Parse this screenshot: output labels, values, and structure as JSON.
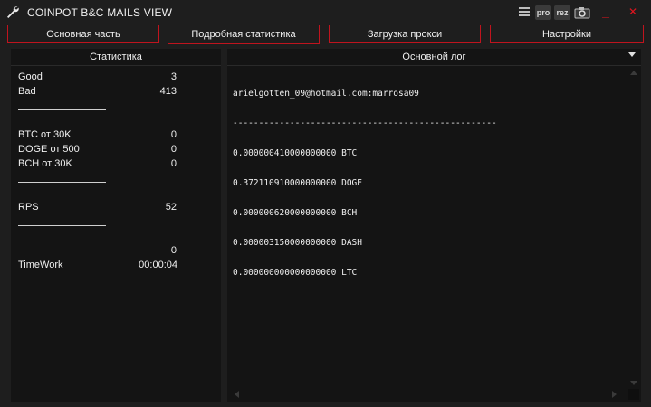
{
  "window": {
    "title": "COINPOT B&C MAILS VIEW"
  },
  "toolbar": {
    "icons": [
      "list-icon",
      "pro-icon",
      "rez-icon",
      "camera-icon"
    ],
    "pro_label": "pro",
    "rez_label": "rez",
    "minimize": "_",
    "close": "✕"
  },
  "tabs": [
    {
      "label": "Основная часть"
    },
    {
      "label": "Подробная статистика"
    },
    {
      "label": "Загрузка прокси"
    },
    {
      "label": "Настройки"
    }
  ],
  "stats_panel": {
    "title": "Статистика",
    "rows": [
      {
        "label": "Good",
        "value": "3"
      },
      {
        "label": "Bad",
        "value": "413"
      },
      {
        "label": "BTC от 30K",
        "value": "0"
      },
      {
        "label": "DOGE от 500",
        "value": "0"
      },
      {
        "label": "BCH от 30K",
        "value": "0"
      },
      {
        "label": "RPS",
        "value": "52"
      },
      {
        "label": "",
        "value": "0"
      },
      {
        "label": "TimeWork",
        "value": "00:00:04"
      }
    ]
  },
  "log_panel": {
    "title": "Основной лог",
    "lines": [
      "arielgotten_09@hotmail.com:marrosa09",
      "---------------------------------------------------",
      "0.000000410000000000 BTC",
      "0.372110910000000000 DOGE",
      "0.000000620000000000 BCH",
      "0.000003150000000000 DASH",
      "0.000000000000000000 LTC"
    ]
  },
  "colors": {
    "accent": "#c0141e",
    "background": "#1e1e1e",
    "panel": "#141414"
  }
}
